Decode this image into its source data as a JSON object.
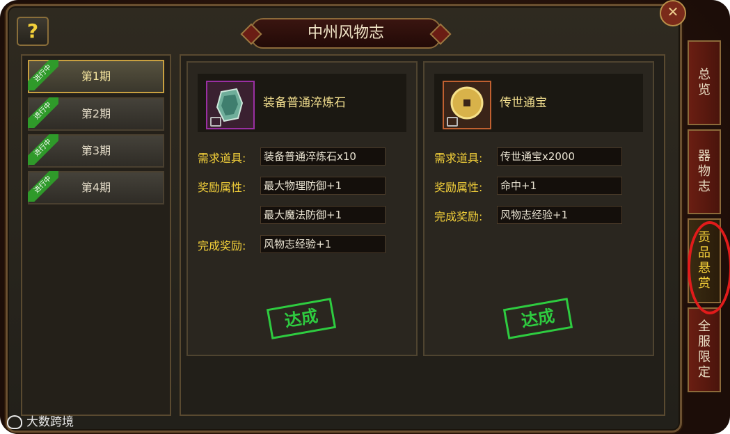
{
  "window": {
    "title": "中州风物志",
    "help_label": "?"
  },
  "periods": [
    {
      "label": "第1期",
      "status": "进行中",
      "active": true
    },
    {
      "label": "第2期",
      "status": "进行中",
      "active": false
    },
    {
      "label": "第3期",
      "status": "进行中",
      "active": false
    },
    {
      "label": "第4期",
      "status": "进行中",
      "active": false
    }
  ],
  "cards": [
    {
      "item_name": "装备普通淬炼石",
      "icon": "jade-stone-icon",
      "required_label": "需求道具:",
      "required_value": "装备普通淬炼石x10",
      "reward_attr_label": "奖励属性:",
      "reward_attrs": [
        "最大物理防御+1",
        "最大魔法防御+1"
      ],
      "completion_label": "完成奖励:",
      "completion_value": "风物志经验+1",
      "stamp": "达成"
    },
    {
      "item_name": "传世通宝",
      "icon": "gold-coin-icon",
      "required_label": "需求道具:",
      "required_value": "传世通宝x2000",
      "reward_attr_label": "奖励属性:",
      "reward_attrs": [
        "命中+1"
      ],
      "completion_label": "完成奖励:",
      "completion_value": "风物志经验+1",
      "stamp": "达成"
    }
  ],
  "tabs": [
    {
      "label": "总览",
      "active": false
    },
    {
      "label": "器物志",
      "active": false
    },
    {
      "label": "贡品悬赏",
      "active": true
    },
    {
      "label": "全服限定",
      "active": false
    }
  ],
  "watermark": "大数跨境",
  "colors": {
    "accent_gold": "#f3d03a",
    "stamp_green": "#2ecc40",
    "highlight_red": "#e11b1b"
  }
}
